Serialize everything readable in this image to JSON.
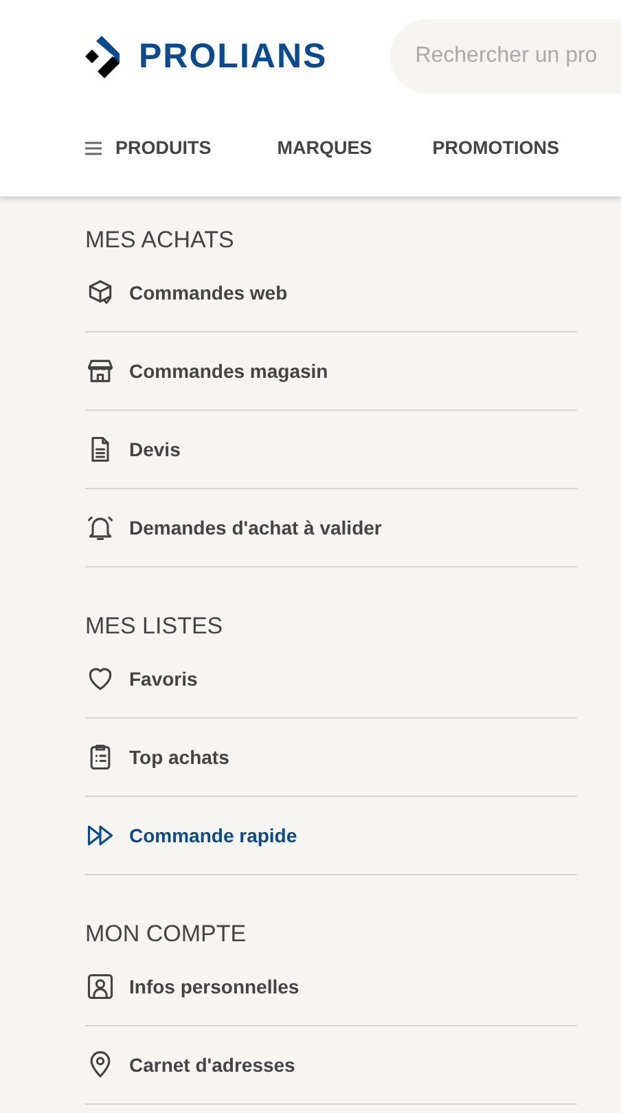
{
  "header": {
    "logo_text": "PROLIANS",
    "search": {
      "placeholder": "Rechercher un pro"
    }
  },
  "nav": [
    {
      "label": "PRODUITS",
      "menu": true
    },
    {
      "label": "MARQUES",
      "menu": false
    },
    {
      "label": "PROMOTIONS",
      "menu": false
    }
  ],
  "sections": [
    {
      "title": "MES ACHATS",
      "items": [
        {
          "label": "Commandes web",
          "selected": false
        },
        {
          "label": "Commandes magasin",
          "selected": false
        },
        {
          "label": "Devis",
          "selected": false
        },
        {
          "label": "Demandes d'achat à valider",
          "selected": false
        }
      ]
    },
    {
      "title": "MES LISTES",
      "items": [
        {
          "label": "Favoris",
          "selected": false
        },
        {
          "label": "Top achats",
          "selected": false
        },
        {
          "label": "Commande rapide",
          "selected": true
        }
      ]
    },
    {
      "title": "MON COMPTE",
      "items": [
        {
          "label": "Infos personnelles",
          "selected": false
        },
        {
          "label": "Carnet d'adresses",
          "selected": false
        }
      ]
    }
  ]
}
